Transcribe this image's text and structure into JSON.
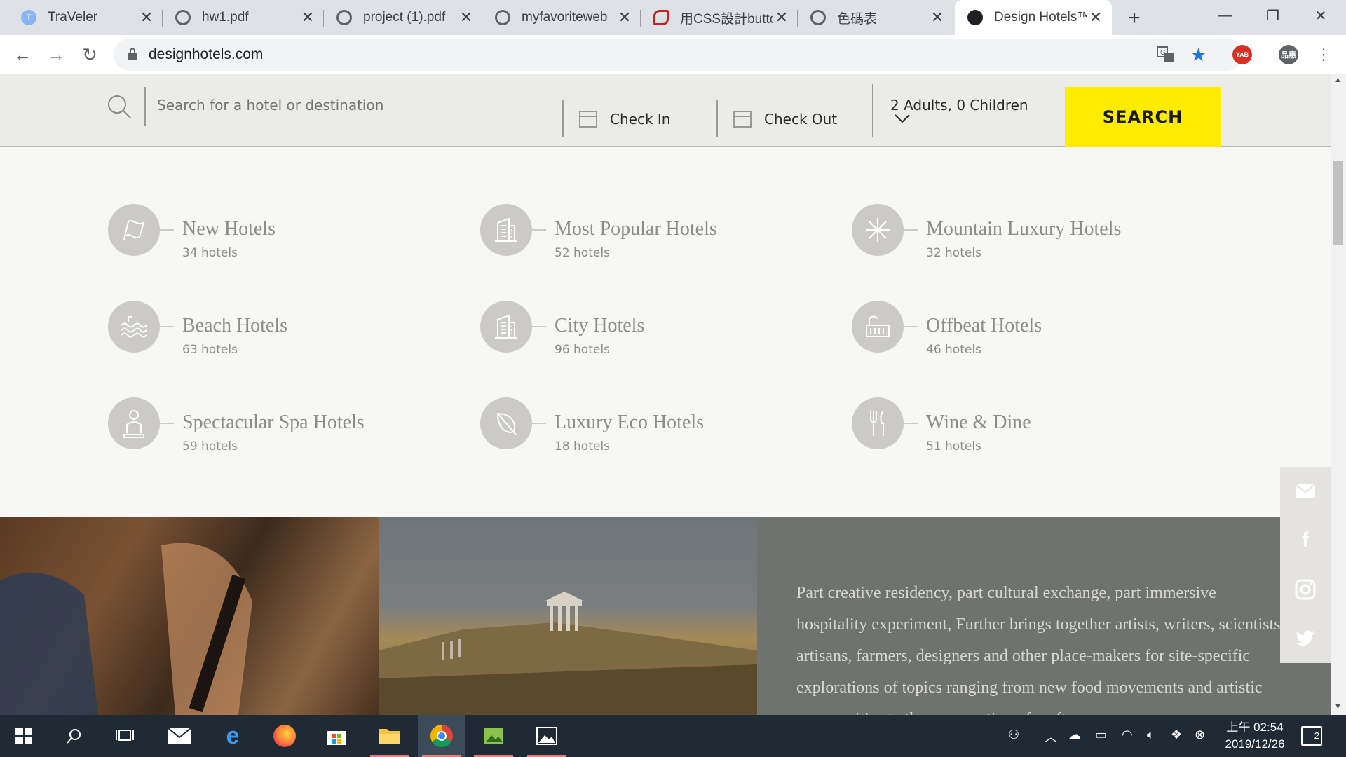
{
  "browser": {
    "tabs": [
      {
        "title": "TraVeler",
        "favicon_color": "#8ab4f8",
        "favicon_letter": "T"
      },
      {
        "title": "hw1.pdf",
        "favicon_color": "#5f6368"
      },
      {
        "title": "project (1).pdf",
        "favicon_color": "#5f6368"
      },
      {
        "title": "myfavoriteweb",
        "favicon_color": "#5f6368"
      },
      {
        "title": "用CSS設計butto",
        "favicon_color": "#c5221f"
      },
      {
        "title": "色碼表",
        "favicon_color": "#5f6368"
      },
      {
        "title": "Design Hotels™",
        "favicon_color": "#202124"
      }
    ],
    "url": "designhotels.com",
    "profile_label": "品惠",
    "ext_label": "YAB"
  },
  "search_bar": {
    "placeholder": "Search for a hotel or destination",
    "check_in": "Check In",
    "check_out": "Check Out",
    "guests": "2 Adults, 0 Children",
    "button": "SEARCH"
  },
  "categories": [
    {
      "name": "New Hotels",
      "count": "34 hotels",
      "icon": "flag-icon"
    },
    {
      "name": "Most Popular Hotels",
      "count": "52 hotels",
      "icon": "building-icon"
    },
    {
      "name": "Mountain Luxury Hotels",
      "count": "32 hotels",
      "icon": "snowflake-icon"
    },
    {
      "name": "Beach Hotels",
      "count": "63 hotels",
      "icon": "waves-icon"
    },
    {
      "name": "City Hotels",
      "count": "96 hotels",
      "icon": "building-icon"
    },
    {
      "name": "Offbeat Hotels",
      "count": "46 hotels",
      "icon": "offbeat-building-icon"
    },
    {
      "name": "Spectacular Spa Hotels",
      "count": "59 hotels",
      "icon": "spa-person-icon"
    },
    {
      "name": "Luxury Eco Hotels",
      "count": "18 hotels",
      "icon": "leaf-icon"
    },
    {
      "name": "Wine & Dine",
      "count": "51 hotels",
      "icon": "fork-knife-icon"
    }
  ],
  "about_text": "Part creative residency, part cultural exchange, part immersive hospitality experiment, Further brings together artists, writers, scientists, artisans, farmers, designers and other place-makers for site-specific explorations of topics ranging from new food movements and artistic communities to the preservation of craft",
  "social": [
    "mail-icon",
    "facebook-icon",
    "instagram-icon",
    "twitter-icon"
  ],
  "taskbar": {
    "time": "上午 02:54",
    "date": "2019/12/26",
    "notifications": "2"
  },
  "colors": {
    "accent_yellow": "#ffec00",
    "category_gray": "#8e8c86",
    "icon_circle": "#cbcac6"
  }
}
